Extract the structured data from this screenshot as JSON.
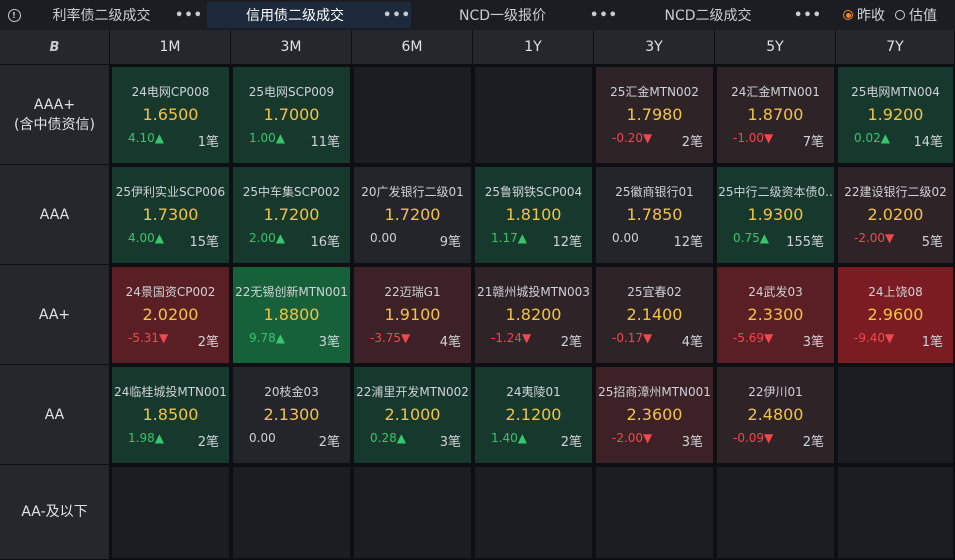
{
  "tabs": [
    {
      "label": "利率债二级成交"
    },
    {
      "label": "信用债二级成交"
    },
    {
      "label": "NCD一级报价"
    },
    {
      "label": "NCD二级成交"
    }
  ],
  "more_label": "•••",
  "radios": [
    {
      "label": "昨收",
      "selected": true
    },
    {
      "label": "估值",
      "selected": false
    }
  ],
  "corner_icon": "B",
  "columns": [
    "1M",
    "3M",
    "6M",
    "1Y",
    "3Y",
    "5Y",
    "7Y"
  ],
  "rows": [
    {
      "label_line1": "AAA+",
      "label_line2": "(含中债资信)",
      "cells": [
        {
          "name": "24电网CP008",
          "rate": "1.6500",
          "chg": "4.10▲",
          "dir": "up",
          "count": "1笔",
          "tone": "g1"
        },
        {
          "name": "25电网SCP009",
          "rate": "1.7000",
          "chg": "1.00▲",
          "dir": "up",
          "count": "11笔",
          "tone": "g1"
        },
        null,
        null,
        {
          "name": "25汇金MTN002",
          "rate": "1.7980",
          "chg": "-0.20▼",
          "dir": "dn",
          "count": "2笔",
          "tone": "r1"
        },
        {
          "name": "24汇金MTN001",
          "rate": "1.8700",
          "chg": "-1.00▼",
          "dir": "dn",
          "count": "7笔",
          "tone": "r1"
        },
        {
          "name": "25电网MTN004",
          "rate": "1.9200",
          "chg": "0.02▲",
          "dir": "up",
          "count": "14笔",
          "tone": "g1"
        }
      ]
    },
    {
      "label_line1": "AAA",
      "label_line2": "",
      "cells": [
        {
          "name": "25伊利实业SCP006",
          "rate": "1.7300",
          "chg": "4.00▲",
          "dir": "up",
          "count": "15笔",
          "tone": "g1"
        },
        {
          "name": "25中车集SCP002",
          "rate": "1.7200",
          "chg": "2.00▲",
          "dir": "up",
          "count": "16笔",
          "tone": "g1"
        },
        {
          "name": "20广发银行二级01",
          "rate": "1.7200",
          "chg": "0.00",
          "dir": "flat",
          "count": "9笔",
          "tone": "n"
        },
        {
          "name": "25鲁钢铁SCP004",
          "rate": "1.8100",
          "chg": "1.17▲",
          "dir": "up",
          "count": "12笔",
          "tone": "g1"
        },
        {
          "name": "25徽商银行01",
          "rate": "1.7850",
          "chg": "0.00",
          "dir": "flat",
          "count": "12笔",
          "tone": "n"
        },
        {
          "name": "25中行二级资本债0..",
          "rate": "1.9300",
          "chg": "0.75▲",
          "dir": "up",
          "count": "155笔",
          "tone": "g1"
        },
        {
          "name": "22建设银行二级02",
          "rate": "2.0200",
          "chg": "-2.00▼",
          "dir": "dn",
          "count": "5笔",
          "tone": "r1"
        }
      ]
    },
    {
      "label_line1": "AA+",
      "label_line2": "",
      "cells": [
        {
          "name": "24景国资CP002",
          "rate": "2.0200",
          "chg": "-5.31▼",
          "dir": "dn",
          "count": "2笔",
          "tone": "r3"
        },
        {
          "name": "22无锡创新MTN001",
          "rate": "1.8800",
          "chg": "9.78▲",
          "dir": "up",
          "count": "3笔",
          "tone": "g3"
        },
        {
          "name": "22迈瑞G1",
          "rate": "1.9100",
          "chg": "-3.75▼",
          "dir": "dn",
          "count": "4笔",
          "tone": "r2"
        },
        {
          "name": "21赣州城投MTN003",
          "rate": "1.8200",
          "chg": "-1.24▼",
          "dir": "dn",
          "count": "2笔",
          "tone": "r1"
        },
        {
          "name": "25宜春02",
          "rate": "2.1400",
          "chg": "-0.17▼",
          "dir": "dn",
          "count": "4笔",
          "tone": "r1"
        },
        {
          "name": "24武发03",
          "rate": "2.3300",
          "chg": "-5.69▼",
          "dir": "dn",
          "count": "3笔",
          "tone": "r3"
        },
        {
          "name": "24上饶08",
          "rate": "2.9600",
          "chg": "-9.40▼",
          "dir": "dn",
          "count": "1笔",
          "tone": "r4"
        }
      ]
    },
    {
      "label_line1": "AA",
      "label_line2": "",
      "cells": [
        {
          "name": "24临桂城投MTN001",
          "rate": "1.8500",
          "chg": "1.98▲",
          "dir": "up",
          "count": "2笔",
          "tone": "g1"
        },
        {
          "name": "20枝金03",
          "rate": "2.1300",
          "chg": "0.00",
          "dir": "flat",
          "count": "2笔",
          "tone": "n"
        },
        {
          "name": "22浦里开发MTN002",
          "rate": "2.1000",
          "chg": "0.28▲",
          "dir": "up",
          "count": "3笔",
          "tone": "g1"
        },
        {
          "name": "24夷陵01",
          "rate": "2.1200",
          "chg": "1.40▲",
          "dir": "up",
          "count": "2笔",
          "tone": "g1"
        },
        {
          "name": "25招商漳州MTN001",
          "rate": "2.3600",
          "chg": "-2.00▼",
          "dir": "dn",
          "count": "3笔",
          "tone": "r2"
        },
        {
          "name": "22伊川01",
          "rate": "2.4800",
          "chg": "-0.09▼",
          "dir": "dn",
          "count": "2笔",
          "tone": "r1"
        },
        null
      ]
    },
    {
      "label_line1": "AA-及以下",
      "label_line2": "",
      "cells": [
        null,
        null,
        null,
        null,
        null,
        null,
        null
      ]
    }
  ]
}
